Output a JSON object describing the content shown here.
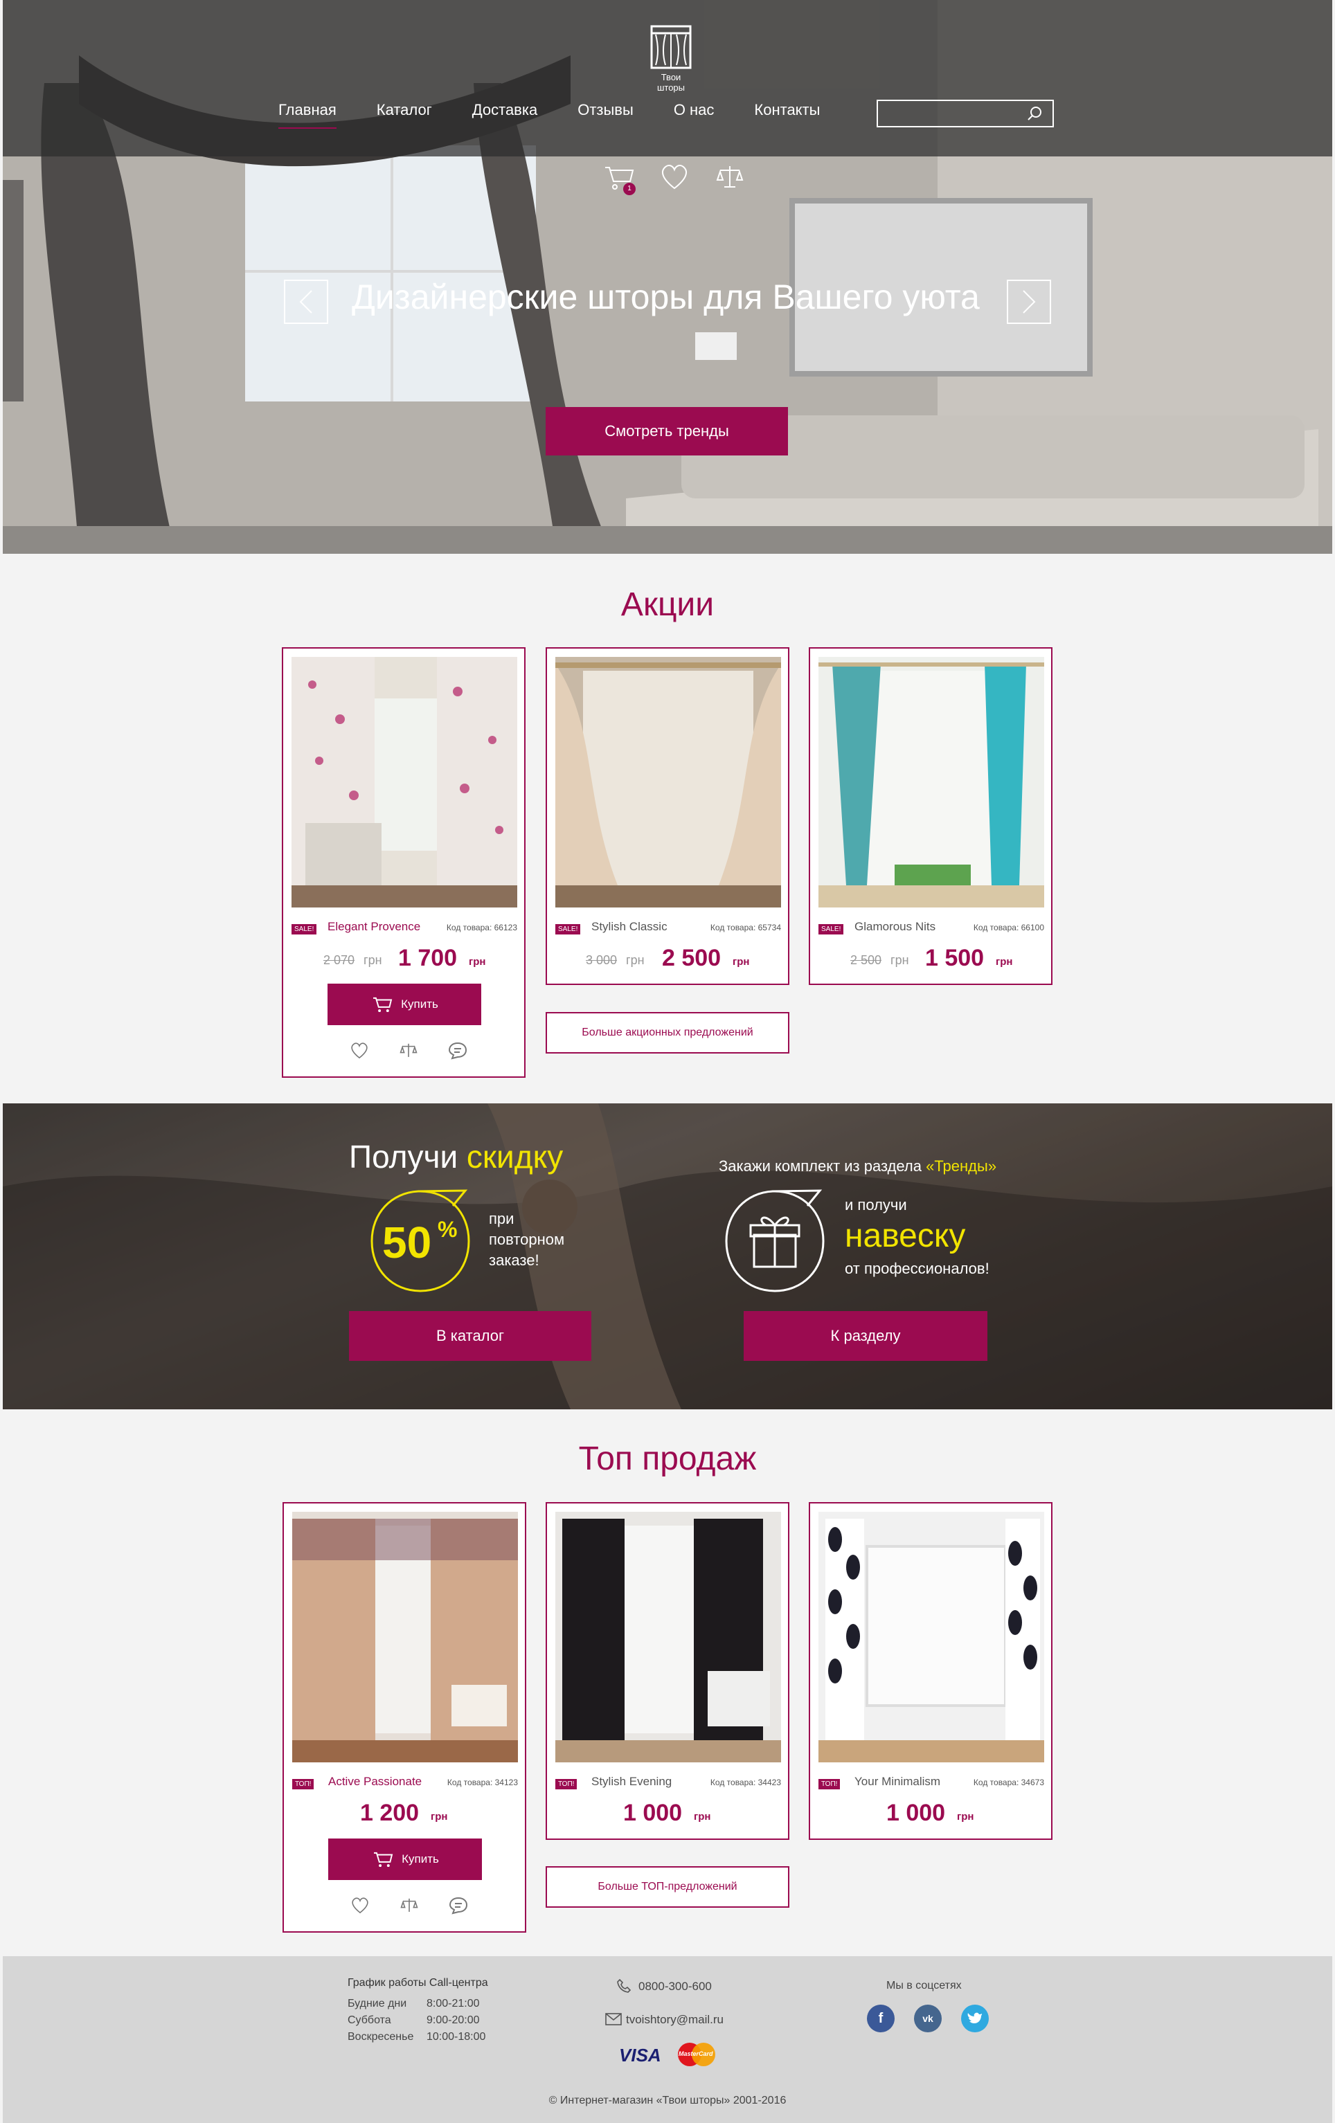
{
  "header": {
    "logo_text": "Твои шторы",
    "nav": [
      {
        "label": "Главная",
        "active": true
      },
      {
        "label": "Каталог",
        "active": false
      },
      {
        "label": "Доставка",
        "active": false
      },
      {
        "label": "Отзывы",
        "active": false
      },
      {
        "label": "О нас",
        "active": false
      },
      {
        "label": "Контакты",
        "active": false
      }
    ],
    "search_placeholder": "",
    "cart_count": "1"
  },
  "hero": {
    "title": "Дизайнерские шторы для Вашего уюта",
    "button": "Смотреть тренды"
  },
  "promotions": {
    "title": "Акции",
    "items": [
      {
        "tag": "SALE!",
        "name": "Elegant Provence",
        "code": "Код товара: 66123",
        "old_price": "2 070",
        "old_currency": "грн",
        "price": "1 700",
        "currency": "грн",
        "buy": "Купить"
      },
      {
        "tag": "SALE!",
        "name": "Stylish Classic",
        "code": "Код товара: 65734",
        "old_price": "3 000",
        "old_currency": "грн",
        "price": "2 500",
        "currency": "грн"
      },
      {
        "tag": "SALE!",
        "name": "Glamorous Nits",
        "code": "Код товара: 66100",
        "old_price": "2 500",
        "old_currency": "грн",
        "price": "1 500",
        "currency": "грн"
      }
    ],
    "more_button": "Больше акционных предложений"
  },
  "banner": {
    "left_title_a": "Получи ",
    "left_title_b": "скидку",
    "discount": "50",
    "percent": "%",
    "discount_text": [
      "при",
      "повторном",
      "заказе!"
    ],
    "left_button": "В каталог",
    "right_title_a": "Закажи комплект из раздела ",
    "right_title_b": "«Тренды»",
    "right_line1": "и получи",
    "right_line2": "навеску",
    "right_line3": "от профессионалов!",
    "right_button": "К разделу"
  },
  "top_sales": {
    "title": "Топ продаж",
    "items": [
      {
        "tag": "ТОП!",
        "name": "Active Passionate",
        "code": "Код товара: 34123",
        "price": "1 200",
        "currency": "грн",
        "buy": "Купить"
      },
      {
        "tag": "ТОП!",
        "name": "Stylish Evening",
        "code": "Код товара: 34423",
        "price": "1 000",
        "currency": "грн"
      },
      {
        "tag": "ТОП!",
        "name": "Your Minimalism",
        "code": "Код товара: 34673",
        "price": "1 000",
        "currency": "грн"
      }
    ],
    "more_button": "Больше ТОП-предложений"
  },
  "footer": {
    "schedule_title": "График работы Call-центра",
    "schedule": [
      {
        "day": "Будние дни",
        "hours": "8:00-21:00"
      },
      {
        "day": "Суббота",
        "hours": "9:00-20:00"
      },
      {
        "day": "Воскресенье",
        "hours": "10:00-18:00"
      }
    ],
    "phone": "0800-300-600",
    "email": "tvoishtory@mail.ru",
    "visa": "VISA",
    "mastercard": "MasterCard",
    "social_title": "Мы в соцсетях",
    "copyright": "© Интернет-магазин «Твои шторы» 2001-2016"
  },
  "colors": {
    "accent": "#9b0b50",
    "yellow": "#f2e400"
  }
}
